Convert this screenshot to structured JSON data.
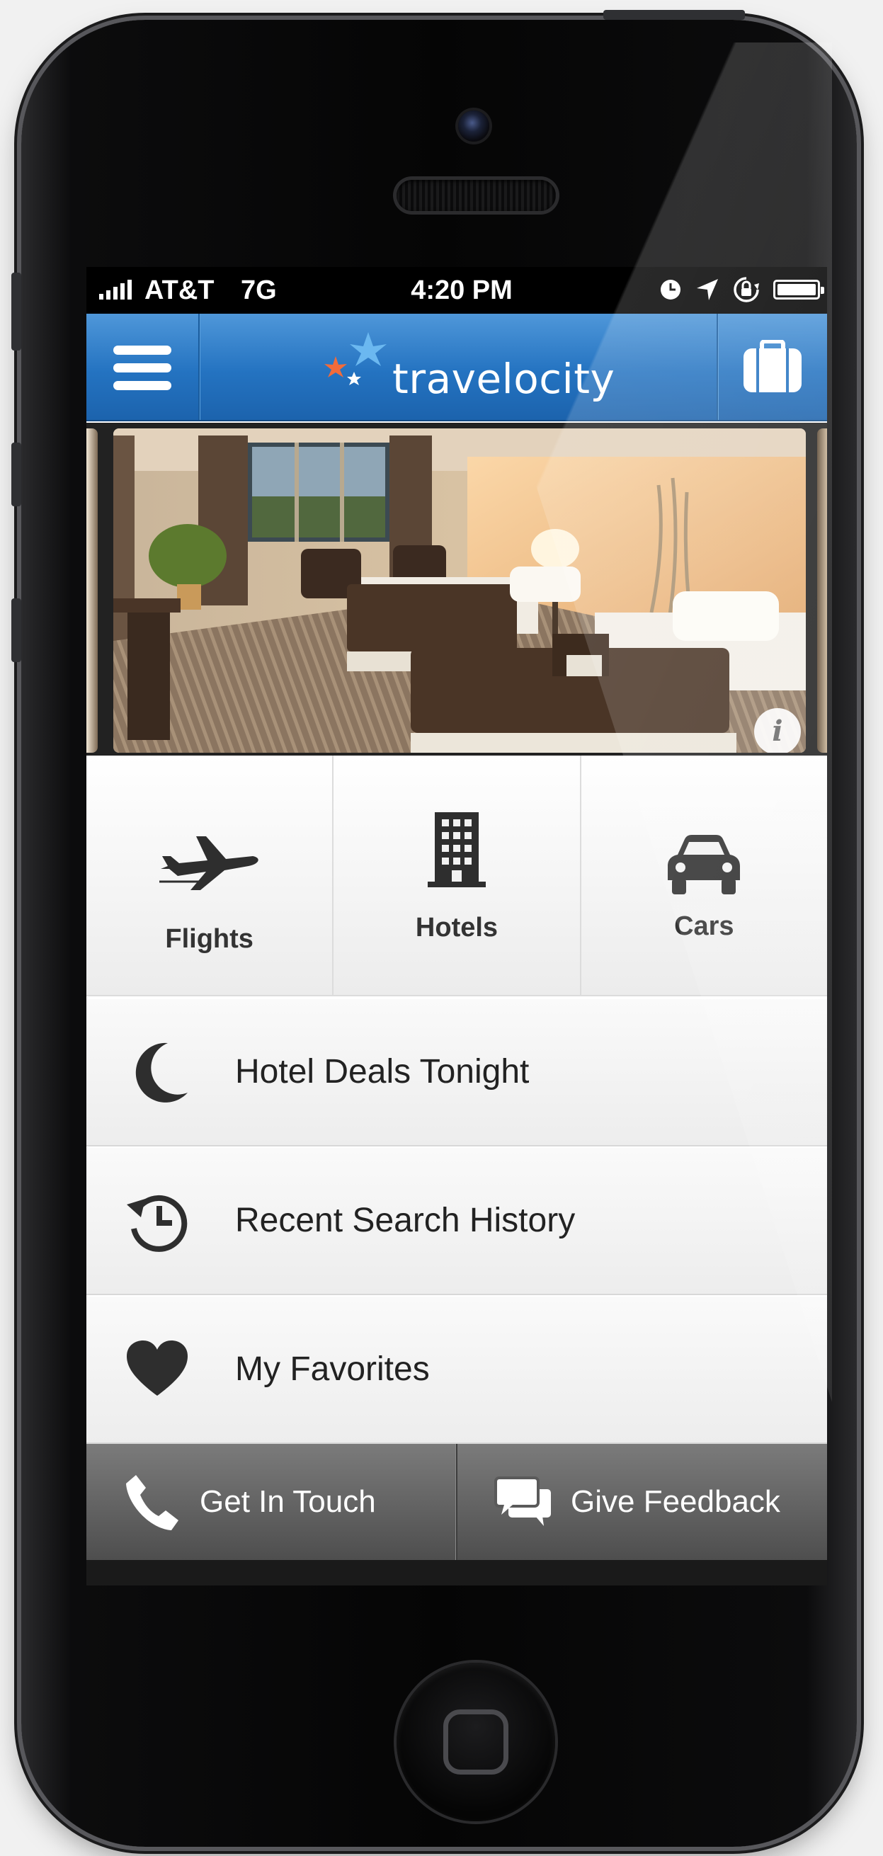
{
  "status_bar": {
    "carrier": "AT&T",
    "network": "7G",
    "time": "4:20 PM",
    "battery_level": 1.0
  },
  "header": {
    "brand_name": "travelocity",
    "menu_icon": "hamburger-icon",
    "trip_icon": "briefcase-icon",
    "brand_colors": {
      "blue": "#2473c1",
      "orange": "#f26b3a",
      "light_blue": "#6bb8f0"
    }
  },
  "carousel": {
    "info_label": "i"
  },
  "categories": [
    {
      "label": "Flights",
      "icon": "airplane-icon"
    },
    {
      "label": "Hotels",
      "icon": "building-icon"
    },
    {
      "label": "Cars",
      "icon": "car-icon"
    }
  ],
  "menu": [
    {
      "label": "Hotel Deals Tonight",
      "icon": "moon-icon"
    },
    {
      "label": "Recent Search History",
      "icon": "history-icon"
    },
    {
      "label": "My Favorites",
      "icon": "heart-icon"
    }
  ],
  "footer": [
    {
      "label": "Get In Touch",
      "icon": "phone-icon"
    },
    {
      "label": "Give Feedback",
      "icon": "chat-bubbles-icon"
    }
  ]
}
